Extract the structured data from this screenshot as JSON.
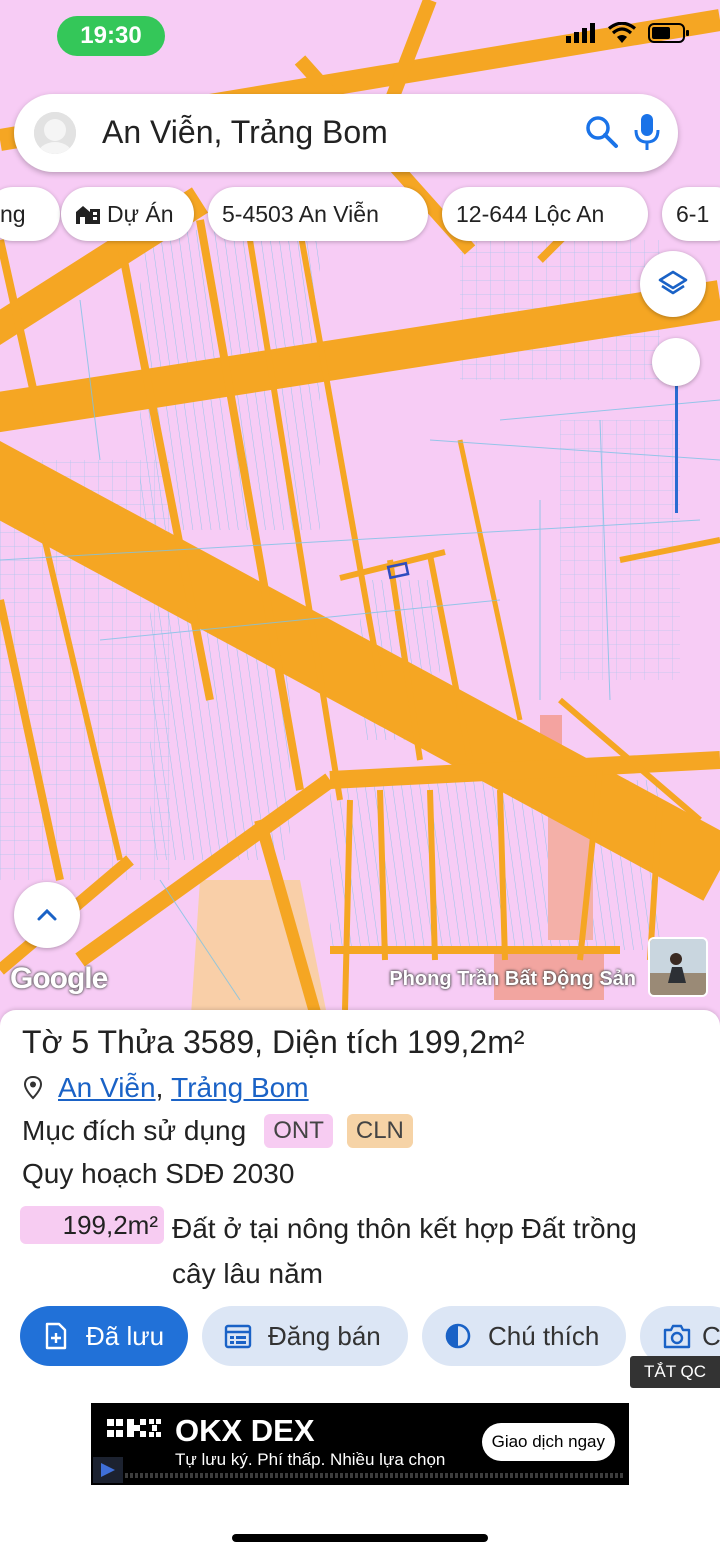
{
  "status_bar": {
    "time": "19:30"
  },
  "search": {
    "query": "An Viễn, Trảng Bom"
  },
  "chips": [
    {
      "label": "ng"
    },
    {
      "label": "Dự Án"
    },
    {
      "label": "5-4503 An Viễn"
    },
    {
      "label": "12-644 Lộc An"
    },
    {
      "label": "6-1"
    }
  ],
  "map": {
    "attribution": "Google",
    "credit": "Phong Trần Bất Động Sản",
    "colors": {
      "land": "#f7ccf5",
      "road": "#f5a623",
      "parcel_line": "#6ec2e8",
      "highlight": "#2f4dbf"
    }
  },
  "parcel": {
    "sheet_label": "Tờ",
    "sheet": "5",
    "plot_label": "Thửa",
    "plot": "3589",
    "area_label": "Diện tích",
    "area": "199,2m²",
    "commune": "An Viễn",
    "district": "Trảng Bom",
    "purpose_label": "Mục đích sử dụng",
    "purpose_tags": [
      "ONT",
      "CLN"
    ],
    "plan_label": "Quy hoạch SDĐ 2030",
    "plan_area": "199,2m²",
    "plan_desc_line1": "Đất ở tại nông thôn kết hợp Đất trồng",
    "plan_desc_line2": "cây lâu năm"
  },
  "actions": [
    {
      "label": "Đã lưu",
      "icon": "bookmark-add-icon"
    },
    {
      "label": "Đăng bán",
      "icon": "calendar-list-icon"
    },
    {
      "label": "Chú thích",
      "icon": "contrast-icon"
    },
    {
      "label": "C",
      "icon": "camera-icon"
    }
  ],
  "ad": {
    "hide_label": "TẮT QC",
    "brand": "OKX DEX",
    "tagline": "Tự lưu ký. Phí thấp. Nhiều lựa chọn",
    "cta": "Giao dịch ngay"
  }
}
